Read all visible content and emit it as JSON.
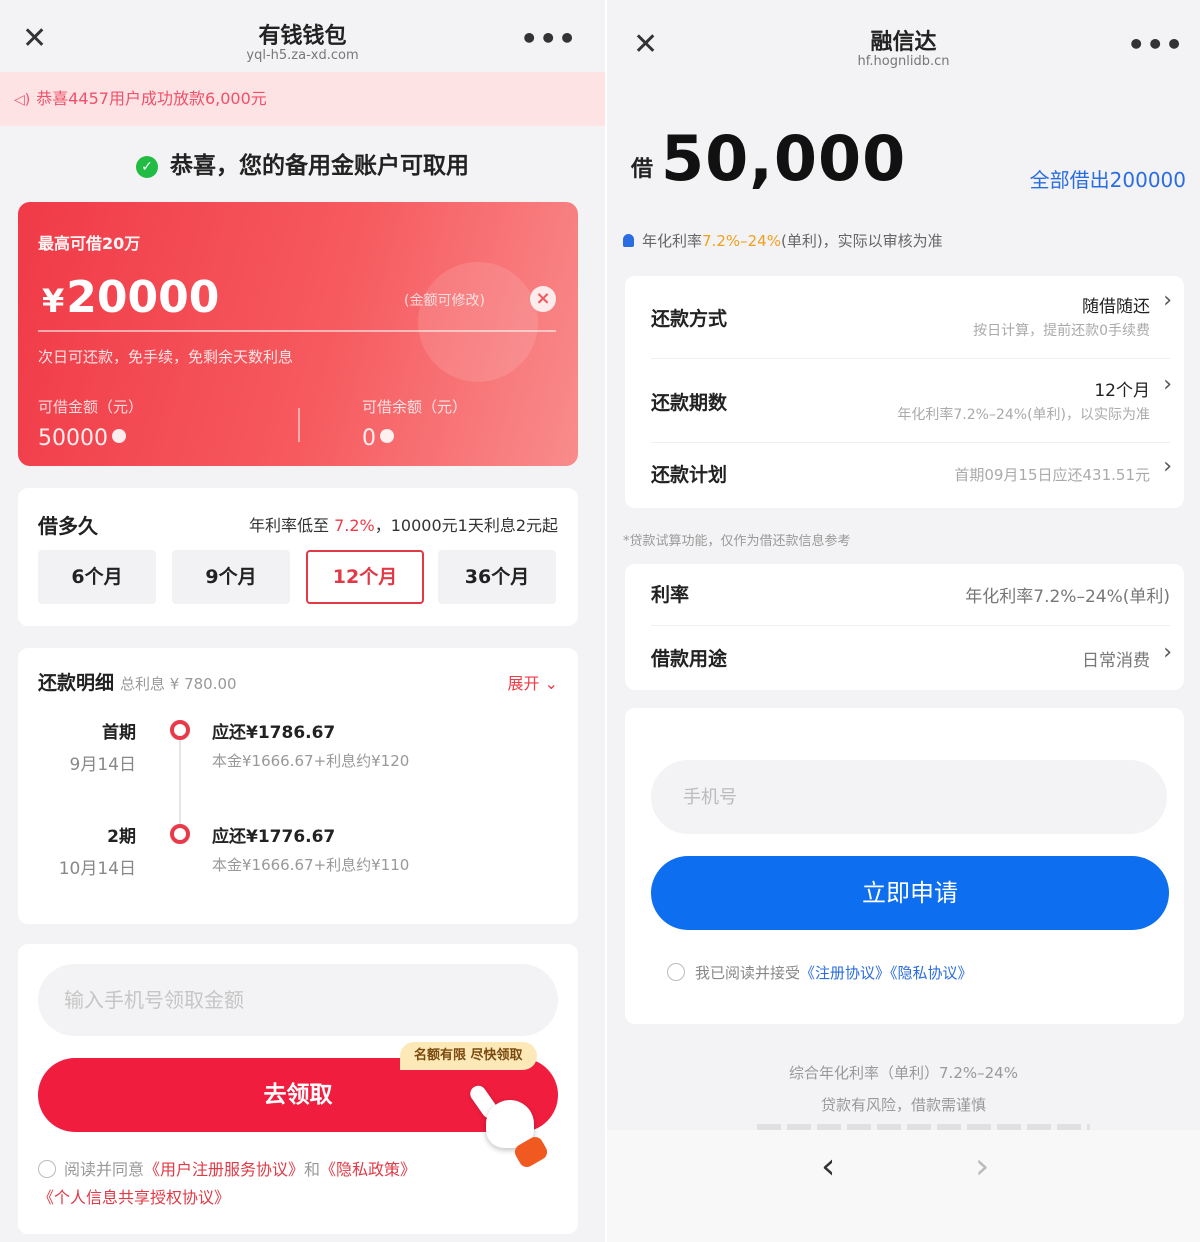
{
  "left": {
    "header": {
      "title": "有钱钱包",
      "domain": "yql-h5.za-xd.com",
      "close": "✕",
      "more": "•••"
    },
    "notice": "恭喜4457用户成功放款6,000元",
    "success_text": "恭喜，您的备用金账户可取用",
    "loan_card": {
      "max_label": "最高可借20万",
      "currency": "¥",
      "amount": "20000",
      "editable_hint": "(金额可修改)",
      "subnote": "次日可还款，免手续，免剩余天数利息",
      "available_label": "可借金额（元）",
      "available_value": "50000",
      "balance_label": "可借余额（元）",
      "balance_value": "0"
    },
    "term": {
      "title": "借多久",
      "rate_prefix": "年利率低至",
      "rate_value": "7.2%",
      "rate_suffix": "，10000元1天利息2元起",
      "options": [
        "6个月",
        "9个月",
        "12个月",
        "36个月"
      ],
      "selected": "12个月"
    },
    "repayment": {
      "title": "还款明细",
      "total_interest": "总利息 ¥ 780.00",
      "expand": "展开",
      "periods": [
        {
          "name": "首期",
          "date": "9月14日",
          "due": "应还¥1786.67",
          "detail": "本金¥1666.67+利息约¥120"
        },
        {
          "name": "2期",
          "date": "10月14日",
          "due": "应还¥1776.67",
          "detail": "本金¥1666.67+利息约¥110"
        }
      ]
    },
    "claim": {
      "phone_placeholder": "输入手机号领取金额",
      "tag": "名额有限 尽快领取",
      "button": "去领取",
      "agree_prefix": "阅读并同意",
      "link1": "《用户注册服务协议》",
      "and": "和",
      "link2": "《隐私政策》",
      "link3": "《个人信息共享授权协议》"
    }
  },
  "right": {
    "header": {
      "title": "融信达",
      "domain": "hf.hognlidb.cn",
      "close": "✕",
      "more": "•••"
    },
    "borrow_label": "借",
    "borrow_amount": "50,000",
    "borrow_all": "全部借出200000",
    "rate_note_prefix": "年化利率",
    "rate_note_range": "7.2%–24%",
    "rate_note_suffix": "(单利)，实际以审核为准",
    "details": [
      {
        "key": "还款方式",
        "value": "随借随还",
        "sub": "按日计算，提前还款0手续费"
      },
      {
        "key": "还款期数",
        "value": "12个月",
        "sub": "年化利率7.2%–24%(单利)，以实际为准"
      },
      {
        "key": "还款计划",
        "value": "首期09月15日应还431.51元"
      }
    ],
    "calc_note": "*贷款试算功能，仅作为借还款信息参考",
    "details2": [
      {
        "key": "利率",
        "value": "年化利率7.2%–24%(单利)"
      },
      {
        "key": "借款用途",
        "value": "日常消费"
      }
    ],
    "phone_placeholder": "手机号",
    "apply_button": "立即申请",
    "agree_prefix": "我已阅读并接受",
    "link1": "《注册协议》",
    "link2": "《隐私协议》",
    "footer_line1": "综合年化利率（单利）7.2%–24%",
    "footer_line2": "贷款有风险，借款需谨慎",
    "nav_back": "‹",
    "nav_forward": "›"
  },
  "colors": {
    "red_accent": "#f03a47",
    "blue_accent": "#0d6ef0",
    "success_green": "#22bb44"
  }
}
